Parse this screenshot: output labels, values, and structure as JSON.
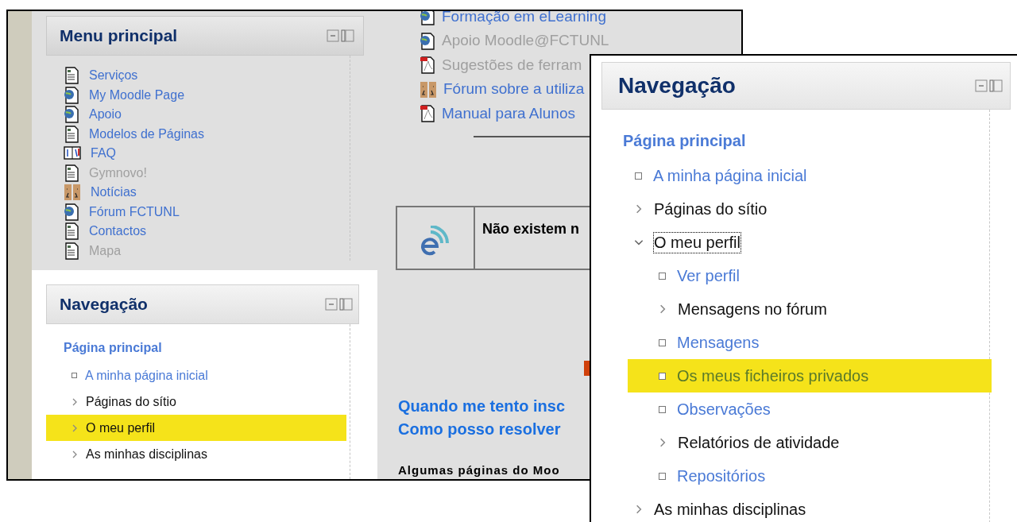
{
  "back_window": {
    "main_menu": {
      "title": "Menu principal",
      "items": [
        {
          "label": "Serviços",
          "kind": "page",
          "dimmed": false
        },
        {
          "label": "My Moodle Page",
          "kind": "globe",
          "dimmed": false
        },
        {
          "label": "Apoio",
          "kind": "globe",
          "dimmed": false
        },
        {
          "label": "Modelos de Páginas",
          "kind": "page",
          "dimmed": false
        },
        {
          "label": "FAQ",
          "kind": "book",
          "dimmed": false
        },
        {
          "label": "Gymnovo!",
          "kind": "page",
          "dimmed": true
        },
        {
          "label": "Notícias",
          "kind": "forum",
          "dimmed": false
        },
        {
          "label": "Fórum FCTUNL",
          "kind": "globe",
          "dimmed": false
        },
        {
          "label": "Contactos",
          "kind": "page",
          "dimmed": false
        },
        {
          "label": "Mapa",
          "kind": "page",
          "dimmed": true
        }
      ]
    },
    "navigation": {
      "title": "Navegação",
      "home": "Página principal",
      "items": [
        {
          "label": "A minha página inicial",
          "kind": "leaf",
          "selected": false,
          "focused": false
        },
        {
          "label": "Páginas do sítio",
          "kind": "branch",
          "expanded": false,
          "selected": false,
          "focused": false
        },
        {
          "label": "O meu perfil",
          "kind": "branch",
          "expanded": false,
          "selected": true,
          "focused": false
        },
        {
          "label": "As minhas disciplinas",
          "kind": "branch",
          "expanded": false,
          "selected": false,
          "focused": false
        }
      ]
    },
    "resources": [
      {
        "label": "Formação em eLearning",
        "kind": "globe",
        "dimmed": false
      },
      {
        "label": "Apoio Moodle@FCTUNL",
        "kind": "globe",
        "dimmed": true
      },
      {
        "label": "Sugestões de ferram",
        "kind": "pdf",
        "dimmed": true
      },
      {
        "label": "Fórum sobre a utiliza",
        "kind": "forum",
        "dimmed": false
      },
      {
        "label": "Manual para Alunos",
        "kind": "pdf",
        "dimmed": false
      }
    ],
    "notice": "Não existem n",
    "question": [
      "Quando me tento insc",
      "Como posso resolver"
    ],
    "body_text": "Algumas páginas do Moo"
  },
  "front_window": {
    "navigation": {
      "title": "Navegação",
      "home": "Página principal",
      "items": [
        {
          "label": "A minha página inicial",
          "kind": "leaf",
          "selected": false,
          "focused": false
        },
        {
          "label": "Páginas do sítio",
          "kind": "branch",
          "expanded": false,
          "selected": false,
          "focused": false
        },
        {
          "label": "O meu perfil",
          "kind": "branch",
          "expanded": true,
          "selected": false,
          "focused": true,
          "children": [
            {
              "label": "Ver perfil",
              "kind": "leaf",
              "selected": false,
              "focused": false
            },
            {
              "label": "Mensagens no fórum",
              "kind": "branch",
              "expanded": false,
              "selected": false,
              "focused": false
            },
            {
              "label": "Mensagens",
              "kind": "leaf",
              "selected": false,
              "focused": false
            },
            {
              "label": "Os meus ficheiros privados",
              "kind": "leaf",
              "selected": true,
              "focused": false
            },
            {
              "label": "Observações",
              "kind": "leaf",
              "selected": false,
              "focused": false
            },
            {
              "label": "Relatórios de atividade",
              "kind": "branch",
              "expanded": false,
              "selected": false,
              "focused": false
            },
            {
              "label": "Repositórios",
              "kind": "leaf",
              "selected": false,
              "focused": false
            }
          ]
        },
        {
          "label": "As minhas disciplinas",
          "kind": "branch",
          "expanded": false,
          "selected": false,
          "focused": false
        }
      ]
    }
  }
}
